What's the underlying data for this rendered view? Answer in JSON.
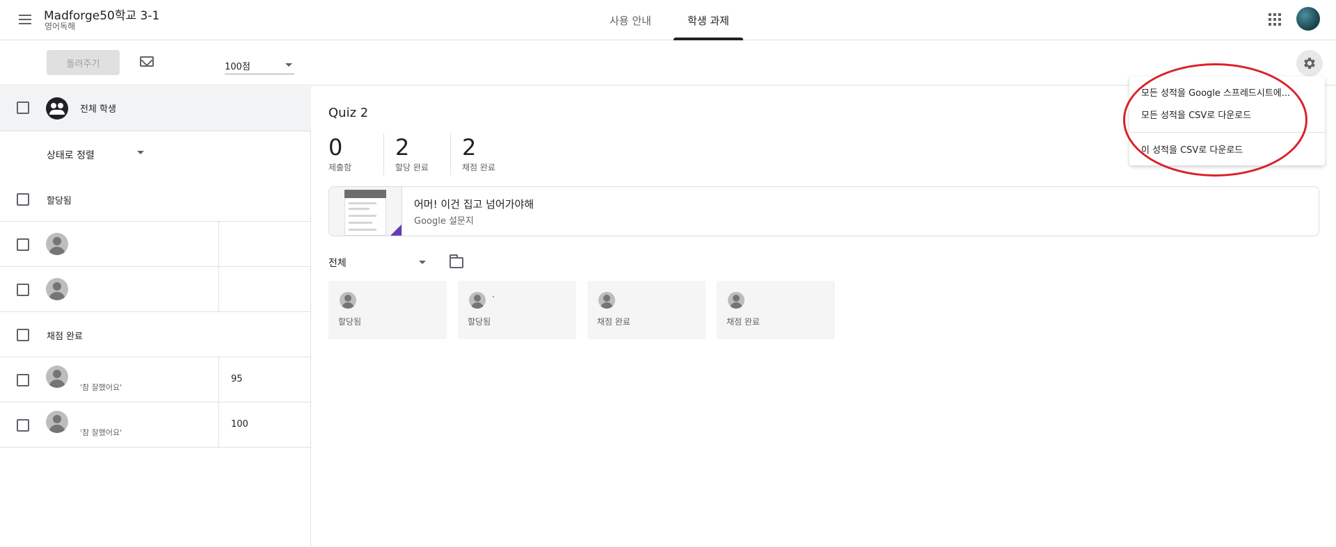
{
  "header": {
    "class_title": "Madforge50학교 3-1",
    "class_subtitle": "영어독해",
    "tabs": [
      {
        "label": "사용 안내",
        "active": false
      },
      {
        "label": "학생 과제",
        "active": true
      }
    ],
    "icons": {
      "menu": "hamburger-menu-icon",
      "apps": "apps-grid-icon",
      "account": "account-avatar"
    }
  },
  "toolbar": {
    "return_label": "돌려주기",
    "points_value": "100점",
    "icons": {
      "email": "mail-icon",
      "settings": "gear-icon"
    }
  },
  "left": {
    "all_students": "전체 학생",
    "sort_label": "상태로 정렬",
    "sections": {
      "assigned": "할당됨",
      "graded": "채점 완료"
    },
    "assigned_students": [
      {
        "name": "",
        "score": ""
      },
      {
        "name": "",
        "score": ""
      }
    ],
    "graded_students": [
      {
        "comment": "'참 잘했어요'",
        "score": "95"
      },
      {
        "comment": "'참 잘했어요'",
        "score": "100"
      }
    ]
  },
  "main": {
    "title": "Quiz 2",
    "stats": [
      {
        "value": "0",
        "label": "제출함"
      },
      {
        "value": "2",
        "label": "할당 완료"
      },
      {
        "value": "2",
        "label": "채점 완료"
      }
    ],
    "attachment": {
      "title": "어머! 이건 집고 넘어가야해",
      "type": "Google 설문지"
    },
    "filter_value": "전체",
    "cards": [
      {
        "status": "할당됨"
      },
      {
        "status": "할당됨"
      },
      {
        "status": "채점 완료"
      },
      {
        "status": "채점 완료"
      }
    ]
  },
  "menu": {
    "items": [
      "모든 성적을 Google 스프레드시트에...",
      "모든 성적을 CSV로 다운로드",
      "이 성적을 CSV로 다운로드"
    ]
  },
  "colors": {
    "annotation": "#d8232a",
    "forms_accent": "#673ab7",
    "text_primary": "#202124",
    "text_secondary": "#5f6368"
  }
}
